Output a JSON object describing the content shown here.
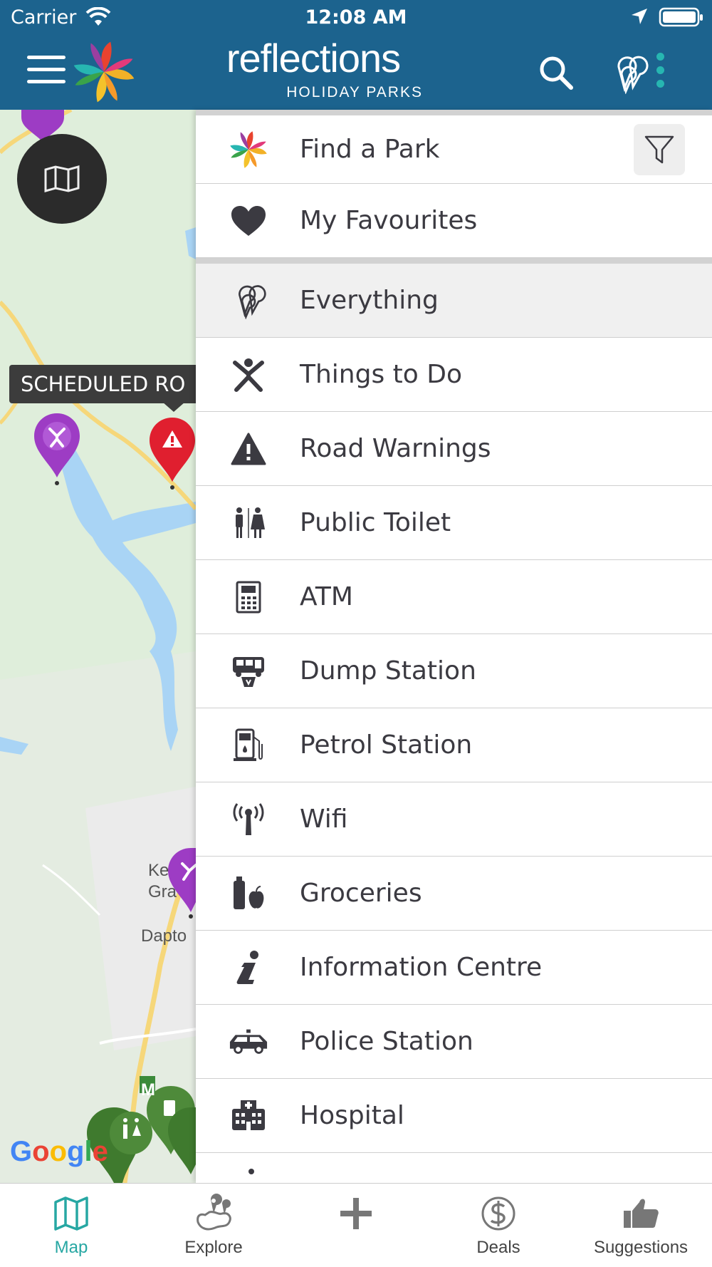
{
  "status_bar": {
    "carrier": "Carrier",
    "time": "12:08 AM"
  },
  "header": {
    "brand_name": "reflections",
    "brand_sub": "HOLIDAY PARKS",
    "menu_icon": "hamburger-icon",
    "search_icon": "search-icon",
    "layers_icon": "balloons-icon",
    "more_icon": "more-vertical-icon",
    "color": "#1c638e"
  },
  "map": {
    "callout": "SCHEDULED RO",
    "labels": [
      "Ke",
      "Gra",
      "Dapto",
      "M"
    ],
    "attribution": "Google"
  },
  "drawer": {
    "find_park": {
      "label": "Find a Park",
      "icon": "pinwheel-logo-icon",
      "filter_icon": "filter-icon"
    },
    "favourites": {
      "label": "My Favourites",
      "icon": "heart-icon"
    },
    "categories": [
      {
        "label": "Everything",
        "icon": "balloons-icon",
        "selected": true
      },
      {
        "label": "Things to Do",
        "icon": "person-jumping-icon",
        "selected": false
      },
      {
        "label": "Road Warnings",
        "icon": "warning-triangle-icon",
        "selected": false
      },
      {
        "label": "Public Toilet",
        "icon": "toilet-icon",
        "selected": false
      },
      {
        "label": "ATM",
        "icon": "atm-icon",
        "selected": false
      },
      {
        "label": "Dump Station",
        "icon": "dump-station-icon",
        "selected": false
      },
      {
        "label": "Petrol Station",
        "icon": "fuel-pump-icon",
        "selected": false
      },
      {
        "label": "Wifi",
        "icon": "wifi-tower-icon",
        "selected": false
      },
      {
        "label": "Groceries",
        "icon": "groceries-icon",
        "selected": false
      },
      {
        "label": "Information Centre",
        "icon": "information-icon",
        "selected": false
      },
      {
        "label": "Police Station",
        "icon": "police-car-icon",
        "selected": false
      },
      {
        "label": "Hospital",
        "icon": "hospital-icon",
        "selected": false
      }
    ]
  },
  "tabbar": {
    "tabs": [
      {
        "label": "Map",
        "icon": "map-icon",
        "active": true
      },
      {
        "label": "Explore",
        "icon": "explore-icon",
        "active": false
      },
      {
        "label": "",
        "icon": "plus-icon",
        "active": false
      },
      {
        "label": "Deals",
        "icon": "dollar-icon",
        "active": false
      },
      {
        "label": "Suggestions",
        "icon": "thumbs-up-icon",
        "active": false
      }
    ],
    "active_color": "#27a7a3"
  }
}
